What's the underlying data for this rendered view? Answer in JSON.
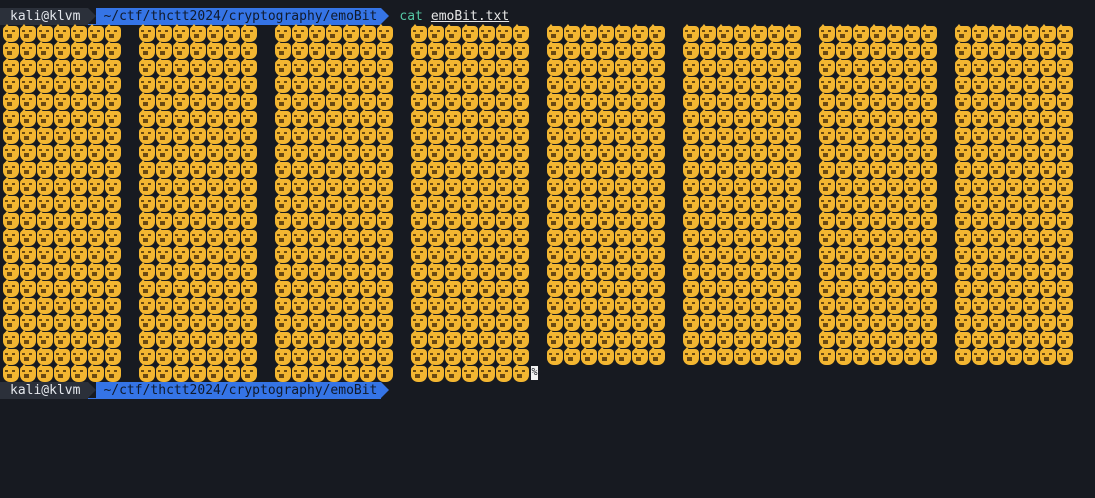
{
  "terminal": {
    "prompt1": {
      "userhost": "kali@klvm",
      "path": "~/ctf/thctt2024/cryptography/emoBit",
      "command": "cat",
      "argument": "emoBit.txt"
    },
    "output": {
      "emoji": "😺",
      "rows": 21,
      "blocks": [
        {
          "cols": 7,
          "rows": 21
        },
        {
          "cols": 7,
          "rows": 21
        },
        {
          "cols": 7,
          "rows": 21
        },
        {
          "cols": 7,
          "rows": 21
        },
        {
          "cols": 7,
          "rows": 20
        },
        {
          "cols": 7,
          "rows": 20
        },
        {
          "cols": 7,
          "rows": 20
        },
        {
          "cols": 7,
          "rows": 20
        }
      ],
      "end_marker": "%"
    },
    "prompt2": {
      "userhost": "kali@klvm",
      "path": "~/ctf/thctt2024/cryptography/emoBit"
    }
  },
  "colors": {
    "background": "#171a21",
    "path_segment": "#3574e6",
    "userhost_segment": "#2b303a",
    "command": "#55c8a5",
    "emoji": "#f3b631"
  }
}
